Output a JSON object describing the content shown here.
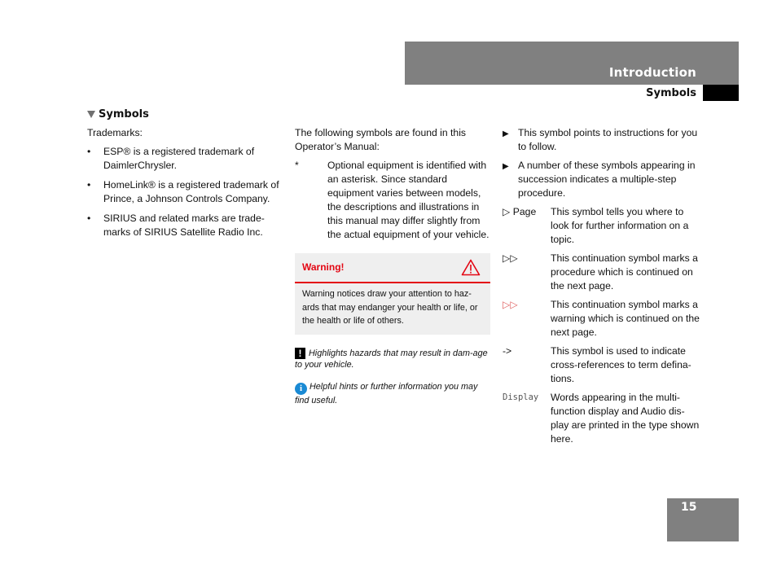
{
  "header": {
    "section": "Introduction",
    "subsection": "Symbols",
    "page_number": "15"
  },
  "column1": {
    "heading": "Symbols",
    "intro": "Trademarks:",
    "bullets": [
      {
        "bullet": "•",
        "text": "ESP® is a registered trademark of DaimlerChrysler."
      },
      {
        "bullet": "•",
        "text": "HomeLink® is a registered trademark of Prince, a Johnson Controls Company."
      },
      {
        "bullet": "•",
        "text": "SIRIUS and related marks are trade-marks of SIRIUS Satellite Radio Inc."
      }
    ]
  },
  "column2": {
    "intro": "The following symbols are found in this Operator’s Manual:",
    "asterisk": {
      "symbol": "*",
      "text": "Optional equipment is identified with an asterisk. Since standard equipment varies between models, the descriptions and illustrations in this manual may differ slightly from the actual equipment of your vehicle."
    },
    "warning": {
      "title": "Warning!",
      "icon": "warning-triangle-icon",
      "body": "Warning notices draw your attention to haz-ards that may endanger your health or life, or the health or life of others.",
      "accent_color": "#e30613"
    },
    "notes": [
      {
        "icon": "exclamation-icon",
        "glyph": "!",
        "text": "Highlights hazards that may result in dam-age to your vehicle."
      },
      {
        "icon": "info-icon",
        "glyph": "i",
        "text": "Helpful hints or further information you may find useful."
      }
    ]
  },
  "column3": {
    "arrows": [
      {
        "symbol": "▶",
        "text": "This symbol points to instructions for you to follow."
      },
      {
        "symbol": "▶",
        "text": "A number of these symbols appearing in succession indicates a multiple-step procedure."
      }
    ],
    "definitions": [
      {
        "symbol": "▷ Page",
        "text": "This symbol tells you where to look for further information on a topic."
      },
      {
        "symbol": "▷▷",
        "text": "This continuation symbol marks a procedure which is continued on the next page."
      },
      {
        "symbol": "▷▷",
        "text": "This continuation symbol marks a warning which is continued on the next page."
      },
      {
        "symbol": "->",
        "text": "This symbol is used to indicate cross-references to term defina-tions."
      },
      {
        "symbol": "Display",
        "text": "Words appearing in the multi-function display and Audio dis-play are printed in the type shown here."
      }
    ]
  }
}
